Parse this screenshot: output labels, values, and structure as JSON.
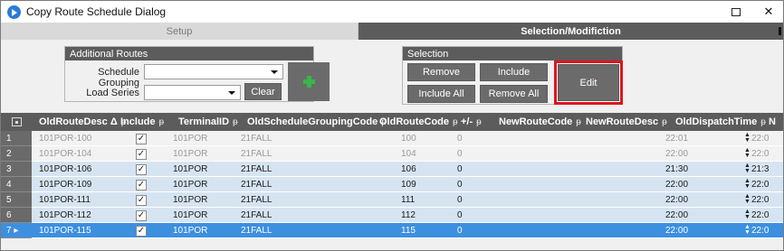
{
  "window": {
    "title": "Copy Route Schedule Dialog",
    "maximize_glyph": "☐",
    "close_glyph": "✕"
  },
  "tabs": [
    {
      "label": "Setup"
    },
    {
      "label": "Selection/Modifiction"
    }
  ],
  "additional_routes": {
    "header": "Additional Routes",
    "schedule_grouping_label": "Schedule Grouping",
    "schedule_grouping_value": "",
    "load_series_label": "Load Series",
    "load_series_value": "",
    "clear_label": "Clear",
    "add_icon": "plus-icon"
  },
  "selection": {
    "header": "Selection",
    "remove_label": "Remove",
    "include_label": "Include",
    "include_all_label": "Include All",
    "remove_all_label": "Remove All",
    "edit_label": "Edit",
    "highlight_color": "#e0141b"
  },
  "grid": {
    "columns": [
      {
        "label": "OldRouteDesc",
        "sort": "Δ",
        "pin": "ᵽ"
      },
      {
        "label": "Include",
        "pin": "ᵽ"
      },
      {
        "label": "TerminalID",
        "pin": "ᵽ"
      },
      {
        "label": "OldScheduleGroupingCode",
        "pin": "ᵽ"
      },
      {
        "label": "OldRouteCode",
        "pin": "ᵽ"
      },
      {
        "label": "+/-",
        "pin": "ᵽ"
      },
      {
        "label": "NewRouteCode",
        "pin": "ᵽ"
      },
      {
        "label": "NewRouteDesc",
        "pin": "ᵽ"
      },
      {
        "label": "OldDispatchTime",
        "pin": "ᵽ"
      },
      {
        "label": "N"
      }
    ],
    "rows": [
      {
        "num": "1",
        "old_desc": "101POR-100",
        "include": true,
        "terminal": "101POR",
        "grouping": "21FALL",
        "old_code": "100",
        "plusminus": "0",
        "new_code": "",
        "new_desc": "",
        "dispatch": "22:01",
        "next": "22:0",
        "style": "grey"
      },
      {
        "num": "2",
        "old_desc": "101POR-104",
        "include": true,
        "terminal": "101POR",
        "grouping": "21FALL",
        "old_code": "104",
        "plusminus": "0",
        "new_code": "",
        "new_desc": "",
        "dispatch": "22:00",
        "next": "22:0",
        "style": "grey"
      },
      {
        "num": "3",
        "old_desc": "101POR-106",
        "include": true,
        "terminal": "101POR",
        "grouping": "21FALL",
        "old_code": "106",
        "plusminus": "0",
        "new_code": "",
        "new_desc": "",
        "dispatch": "21:30",
        "next": "21:3",
        "style": "blue"
      },
      {
        "num": "4",
        "old_desc": "101POR-109",
        "include": true,
        "terminal": "101POR",
        "grouping": "21FALL",
        "old_code": "109",
        "plusminus": "0",
        "new_code": "",
        "new_desc": "",
        "dispatch": "22:00",
        "next": "22:0",
        "style": "blue"
      },
      {
        "num": "5",
        "old_desc": "101POR-111",
        "include": true,
        "terminal": "101POR",
        "grouping": "21FALL",
        "old_code": "111",
        "plusminus": "0",
        "new_code": "",
        "new_desc": "",
        "dispatch": "22:00",
        "next": "22:0",
        "style": "blue"
      },
      {
        "num": "6",
        "old_desc": "101POR-112",
        "include": true,
        "terminal": "101POR",
        "grouping": "21FALL",
        "old_code": "112",
        "plusminus": "0",
        "new_code": "",
        "new_desc": "",
        "dispatch": "22:00",
        "next": "22:0",
        "style": "blue"
      },
      {
        "num": "7 ▸",
        "old_desc": "101POR-115",
        "include": true,
        "terminal": "101POR",
        "grouping": "21FALL",
        "old_code": "115",
        "plusminus": "0",
        "new_code": "",
        "new_desc": "",
        "dispatch": "22:00",
        "next": "22:0",
        "style": "active"
      }
    ]
  },
  "colors": {
    "header_bg": "#5c5c5c",
    "row_blue": "#d6e4f2",
    "row_active": "#3d8fe0"
  }
}
